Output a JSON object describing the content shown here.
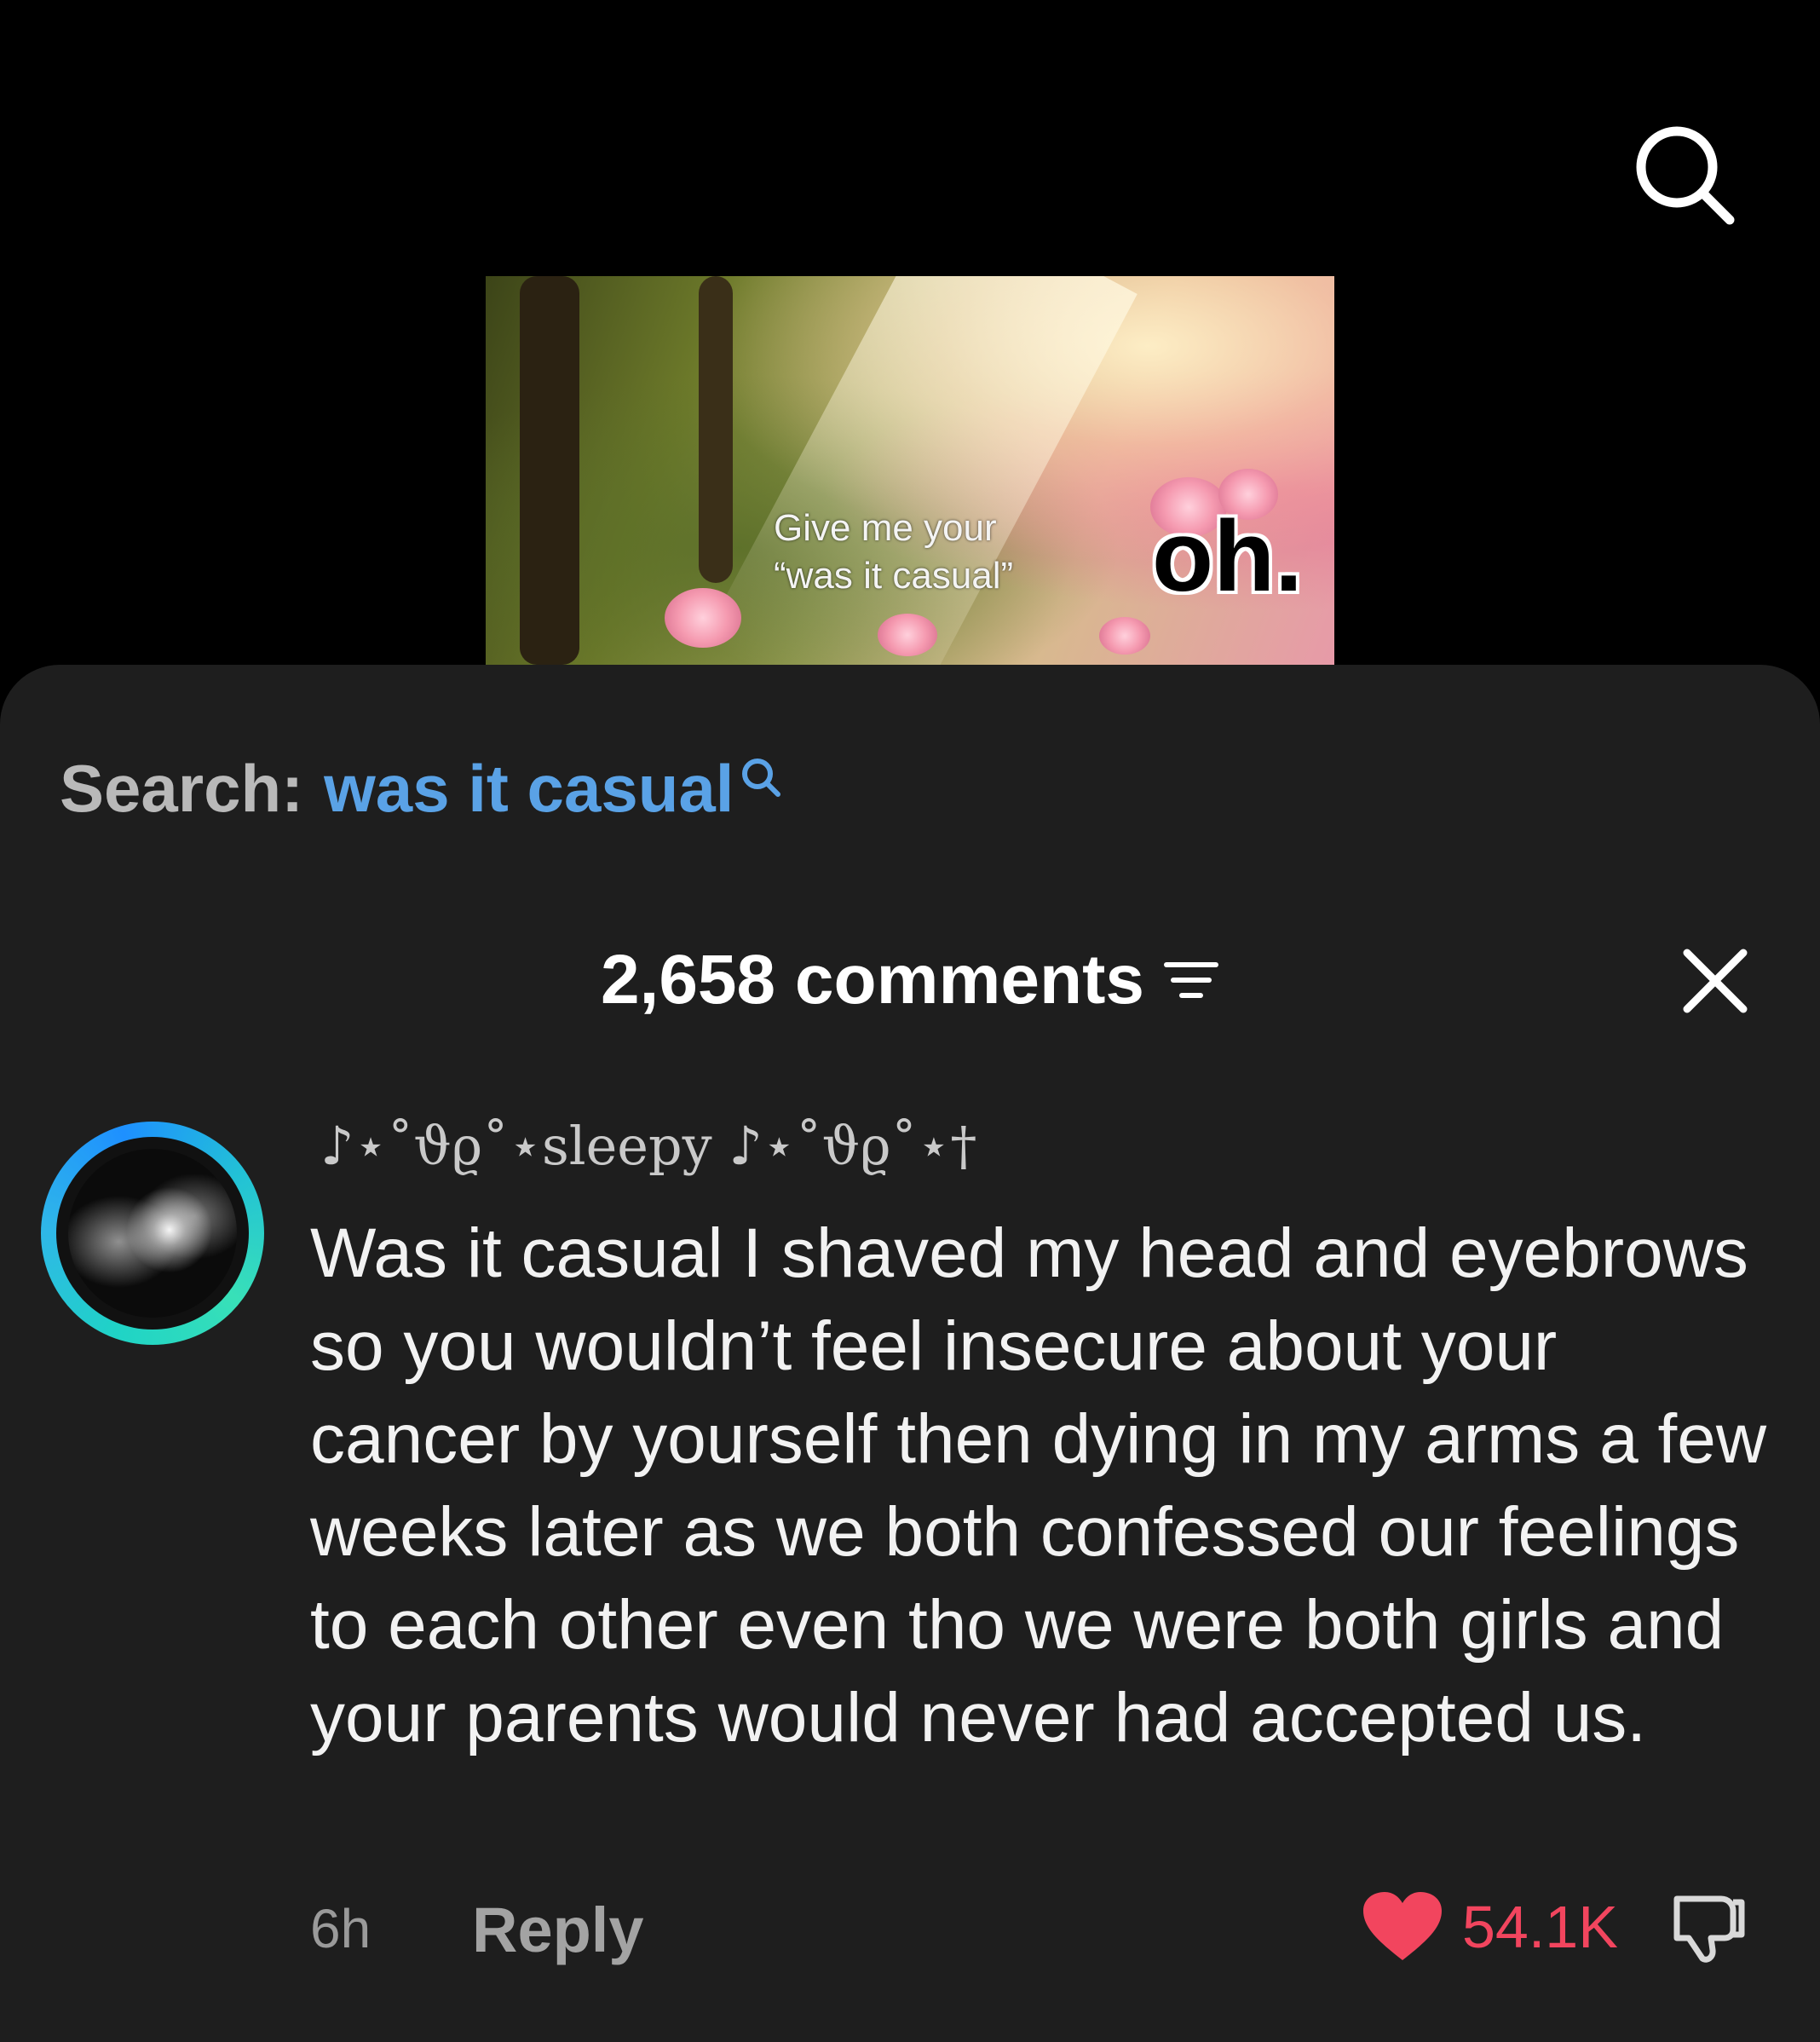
{
  "thumbnail": {
    "caption": "Give me your\n“was it casual”",
    "sticker": "oh."
  },
  "search": {
    "prefix": "Search:",
    "query": "was it casual"
  },
  "comments": {
    "count_label": "2,658 comments"
  },
  "comment": {
    "username": "♪⋆˚ϑϱ˚⋆sleepy ♪⋆˚ϑϱ˚⋆†",
    "text": "Was it casual I shaved my head and eyebrows so you wouldn’t feel insecure about your cancer by yourself then dying in my arms a few weeks later as we both confessed our feelings to each other even tho we were both girls and your parents would never had accepted us.",
    "time": "6h",
    "reply_label": "Reply",
    "likes": "54.1K"
  },
  "colors": {
    "search_query": "#5aa2e6",
    "like": "#f2455e",
    "sheet_bg": "#1e1e1e"
  },
  "icons": [
    "search-icon",
    "sort-icon",
    "close-icon",
    "heart-icon",
    "dislike-icon"
  ]
}
